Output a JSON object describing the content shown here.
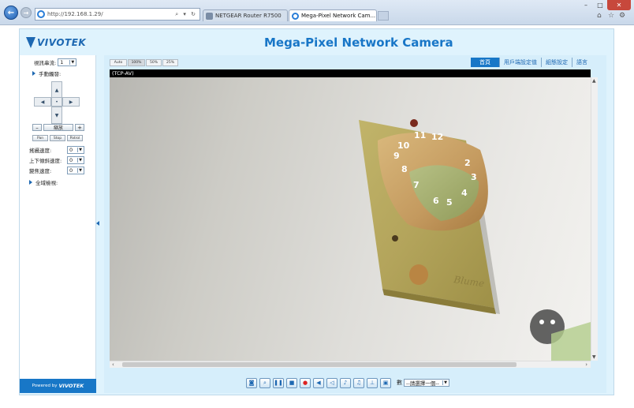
{
  "browser": {
    "url": "http://192.168.1.29/",
    "address_tools": "⌕ ▾ ↻",
    "tabs": [
      {
        "title": "NETGEAR Router R7500"
      },
      {
        "title": "Mega-Pixel Network Cam..."
      }
    ],
    "tab_close": "×",
    "controls": {
      "minimize": "–",
      "maximize": "□",
      "close": "✕"
    }
  },
  "header": {
    "logo": "VIVOTEK",
    "title": "Mega-Pixel Network Camera"
  },
  "sidebar": {
    "stream_label": "視訊串流:",
    "stream_value": "1",
    "manual_trigger": "手動觸發:",
    "zoom_label": "縮放",
    "zoom_minus": "–",
    "zoom_plus": "+",
    "ptz_buttons": [
      "Pan",
      "Stop",
      "Patrol"
    ],
    "speed_rows": [
      {
        "label": "搖攝速度:",
        "value": "0"
      },
      {
        "label": "上下傾斜速度:",
        "value": "0"
      },
      {
        "label": "變焦速度:",
        "value": "0"
      }
    ],
    "global_view": "全域檢視:",
    "powered_by": "Powered by",
    "powered_logo": "VIVOTEK"
  },
  "view": {
    "size_buttons": [
      "Auto",
      "100%",
      "50%",
      "25%"
    ],
    "menu": [
      "首頁",
      "用戶端設定值",
      "組態設定",
      "語言"
    ],
    "stream_header": "(TCP-AV)",
    "digital_label": "數",
    "digital_select": "--請選擇一個--"
  },
  "colors": {
    "accent": "#1877c7",
    "frame_bg": "#dff3fd"
  }
}
